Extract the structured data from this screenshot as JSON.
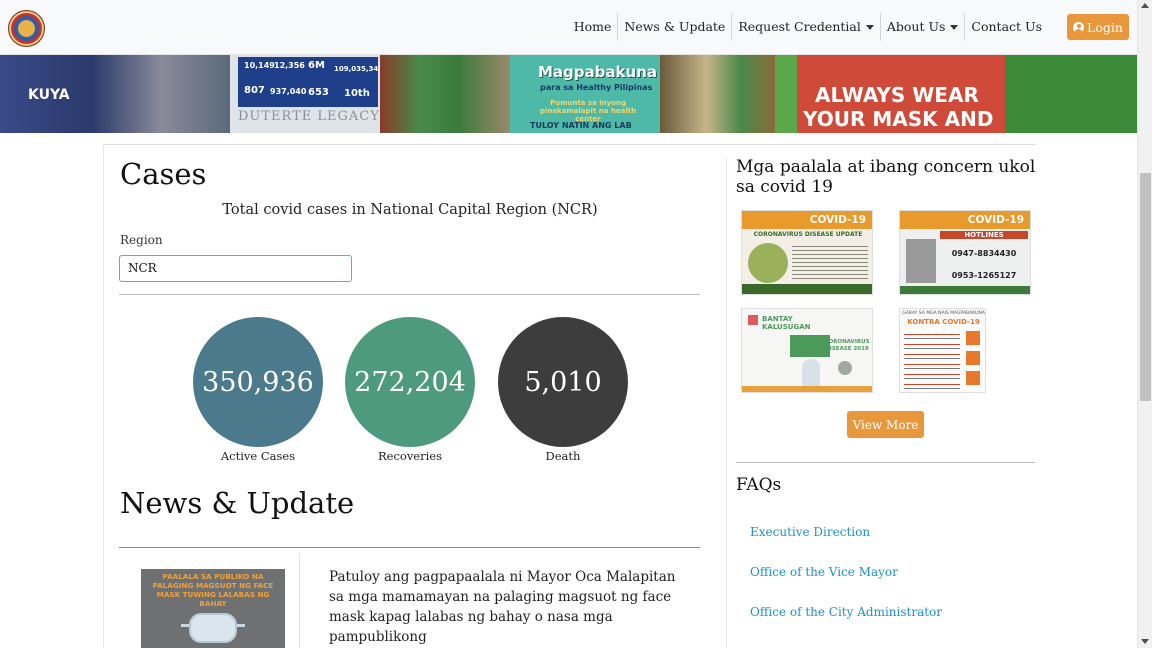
{
  "nav": {
    "items": [
      {
        "label": "Home",
        "dropdown": false
      },
      {
        "label": "News & Update",
        "dropdown": false
      },
      {
        "label": "Request Credential",
        "dropdown": true
      },
      {
        "label": "About Us",
        "dropdown": true
      },
      {
        "label": "Contact Us",
        "dropdown": false
      }
    ],
    "login_label": "Login"
  },
  "banner": {
    "stats_panel": [
      "10,149",
      "12,356",
      "6M",
      "109,035,343",
      "807",
      "937,040",
      "653",
      "10th"
    ],
    "legacy_text": "DUTERTE LEGACY",
    "kuya_text": "KUYA",
    "poster_title": "Magpabakuna",
    "poster_sub": "para sa Healthy Pilipinas",
    "poster_line2": "Pumunta sa inyong pinakamalapit na health center",
    "poster_bottom": "TULOY NATIN ANG LAB",
    "sign_line1": "ALWAYS WEAR",
    "sign_line2": "YOUR MASK AND"
  },
  "cases": {
    "title": "Cases",
    "subtitle": "Total covid cases in National Capital Region (NCR)",
    "region_label": "Region",
    "region_value": "NCR",
    "stats": [
      {
        "value": "350,936",
        "label": "Active Cases",
        "color": "#4a7a8c"
      },
      {
        "value": "272,204",
        "label": "Recoveries",
        "color": "#4d9a7f"
      },
      {
        "value": "5,010",
        "label": "Death",
        "color": "#3d3d3d"
      }
    ]
  },
  "news": {
    "title": "News & Update",
    "thumb_text": "PAALALA SA PUBLIKO NA PALAGING MAGSUOT NG FACE MASK TUWING LALABAS NG BAHAY",
    "excerpt": "Patuloy ang pagpapaalala ni Mayor Oca Malapitan sa mga mamamayan na palaging magsuot ng face mask kapag lalabas ng bahay o nasa mga pampublikong"
  },
  "sidebar": {
    "reminders_title": "Mga paalala at ibang concern ukol sa covid 19",
    "posters": [
      {
        "title": "COVID-19",
        "subtitle": "CORONAVIRUS DISEASE UPDATE",
        "accent": "#e89a2c"
      },
      {
        "title": "COVID-19",
        "subtitle": "HOTLINES",
        "accent": "#e89a2c",
        "lines": [
          "0947-8834430",
          "0953-1265127"
        ]
      },
      {
        "title": "BANTAY KALUSUGAN",
        "subtitle": "CORONAVIRUS DISEASE 2019",
        "accent": "#4c9a5a"
      },
      {
        "title": "KONTRA COVID-19",
        "subtitle": "GABAY SA MGA NAIS MAGPABAKUNA",
        "accent": "#e8782c"
      }
    ],
    "view_more_label": "View More",
    "faqs_title": "FAQs",
    "faq_links": [
      "Executive Direction",
      "Office of the Vice Mayor",
      "Office of the City Administrator"
    ]
  }
}
